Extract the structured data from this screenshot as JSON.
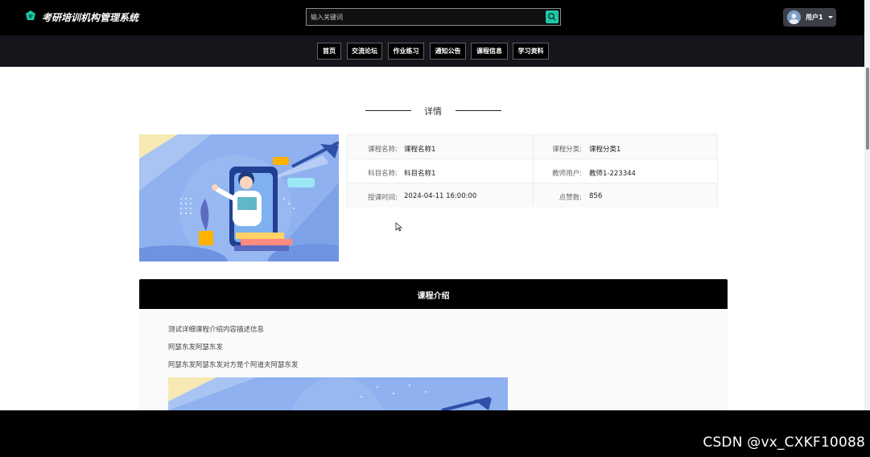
{
  "header": {
    "site_title": "考研培训机构管理系统",
    "search_placeholder": "输入关键词",
    "user_label": "用户1"
  },
  "nav": {
    "items": [
      {
        "label": "首页"
      },
      {
        "label": "交流论坛"
      },
      {
        "label": "作业练习"
      },
      {
        "label": "通知公告"
      },
      {
        "label": "课程信息"
      },
      {
        "label": "学习资料"
      }
    ]
  },
  "detail": {
    "section_title": "详情",
    "fields": [
      {
        "label": "课程名称:",
        "value": "课程名称1"
      },
      {
        "label": "课程分类:",
        "value": "课程分类1"
      },
      {
        "label": "科目名称:",
        "value": "科目名称1"
      },
      {
        "label": "教师用户:",
        "value": "教师1-223344"
      },
      {
        "label": "授课时间:",
        "value": "2024-04-11 16:00:00"
      },
      {
        "label": "点赞数:",
        "value": "856"
      }
    ]
  },
  "intro": {
    "title": "课程介绍",
    "lines": [
      "测试详细课程介绍内容描述信息",
      "阿瑟东发阿瑟东发",
      "阿瑟东发阿瑟东发对方是个阿道夫阿瑟东发"
    ]
  },
  "watermark": "CSDN @vx_CXKF10088",
  "colors": {
    "accent": "#1ec8a5",
    "header_bg": "#000000",
    "nav_bg": "#14161b",
    "hero_bg": "#8fb1ef"
  }
}
